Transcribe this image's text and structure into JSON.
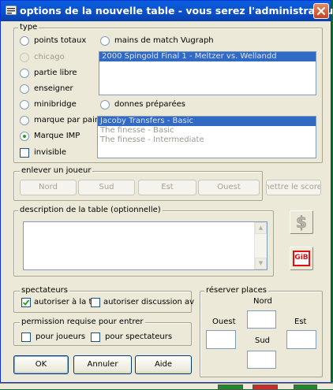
{
  "window": {
    "title": "options de la nouvelle table - vous serez l'administrateur",
    "close_symbol": "✕"
  },
  "type_group": {
    "legend": "type",
    "options": [
      {
        "label": "points totaux",
        "selected": false,
        "enabled": true
      },
      {
        "label": "chicago",
        "selected": false,
        "enabled": false
      },
      {
        "label": "partie libre",
        "selected": false,
        "enabled": true
      },
      {
        "label": "enseigner",
        "selected": false,
        "enabled": true
      },
      {
        "label": "minibridge",
        "selected": false,
        "enabled": true
      },
      {
        "label": "marque par paire",
        "selected": false,
        "enabled": true
      },
      {
        "label": "Marque IMP",
        "selected": true,
        "enabled": true
      }
    ],
    "invisible_label": "invisible",
    "vugraph_label": "mains de match Vugraph",
    "vugraph_items": [
      "2000 Spingold Final 1 - Meltzer vs. Wellandd"
    ],
    "prepared_label": "donnes préparées",
    "prepared_items": [
      "Jacoby Transfers - Basic",
      "The finesse - Basic",
      "The finesse - Intermediate"
    ]
  },
  "remove_player": {
    "legend": "enlever un joueur",
    "buttons": [
      "Nord",
      "Sud",
      "Est",
      "Ouest"
    ],
    "score_button": "mettre le score a"
  },
  "description": {
    "legend": "description de la table (optionnelle)",
    "value": ""
  },
  "tools": {
    "dollar_icon": "dollar-icon",
    "dollar_symbol": "$",
    "gib_label": "GiB"
  },
  "spectators": {
    "legend": "spectateurs",
    "allow_label": "autoriser à la t",
    "allow_checked": true,
    "discussion_label": "autoriser discussion av",
    "discussion_checked": false
  },
  "permission": {
    "legend": "permission requise pour entrer",
    "players_label": "pour joueurs",
    "spectators_label": "pour spectateurs"
  },
  "reserve": {
    "legend": "réserver places",
    "north": "Nord",
    "west": "Ouest",
    "east": "Est",
    "south": "Sud"
  },
  "actions": {
    "ok": "OK",
    "cancel": "Annuler",
    "help": "Aide"
  }
}
